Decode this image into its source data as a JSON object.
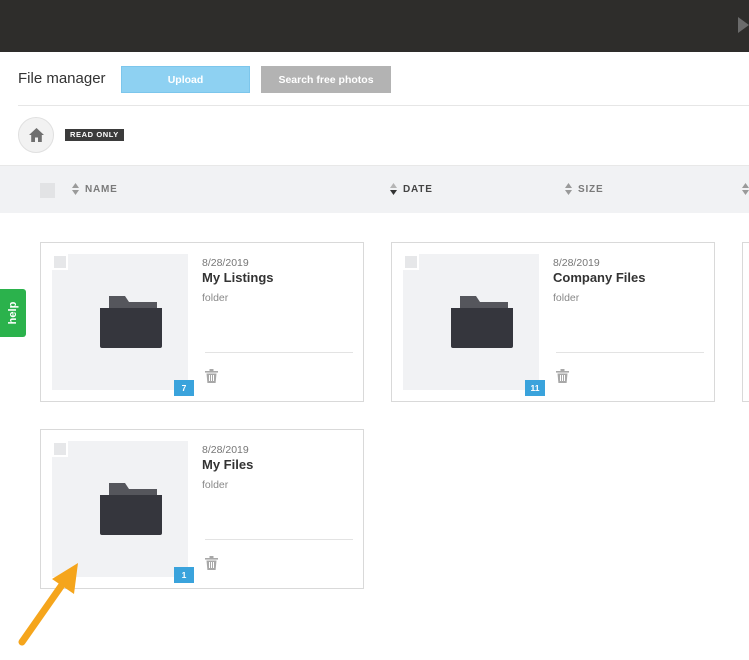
{
  "header": {
    "title": "File manager",
    "upload_label": "Upload",
    "search_photos_label": "Search free photos"
  },
  "toolbar": {
    "badge": "READ ONLY"
  },
  "columns": {
    "name": "NAME",
    "date": "DATE",
    "size": "SIZE"
  },
  "icons": {
    "home": "home-icon",
    "folder": "folder-icon",
    "trash": "trash-icon",
    "sort": "sort-icon"
  },
  "colors": {
    "topbar": "#2e2d2b",
    "upload": "#8ed1f2",
    "search": "#b3b3b3",
    "count_badge": "#3aa3dc",
    "help": "#2bb24c",
    "annotation_arrow": "#f5a51c"
  },
  "help_label": "help",
  "folders": [
    {
      "date": "8/28/2019",
      "name": "My Listings",
      "type": "folder",
      "count": "7"
    },
    {
      "date": "8/28/2019",
      "name": "Company Files",
      "type": "folder",
      "count": "11"
    },
    {
      "date": "8/28/2019",
      "name": "My Files",
      "type": "folder",
      "count": "1"
    }
  ]
}
